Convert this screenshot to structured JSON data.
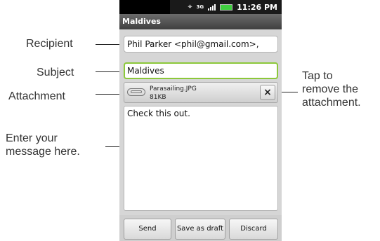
{
  "status_bar": {
    "time": "11:26 PM",
    "network": "3G"
  },
  "title_bar": {
    "title": "Maldives"
  },
  "compose": {
    "recipient_value": "Phil Parker <phil@gmail.com>,",
    "subject_value": "Maldives",
    "attachment": {
      "filename": "Parasailing.JPG",
      "size": "81KB",
      "remove_label": "×"
    },
    "body_text": "Check this out."
  },
  "buttons": {
    "send": "Send",
    "save_draft": "Save as draft",
    "discard": "Discard"
  },
  "callouts": {
    "recipient": "Recipient",
    "subject": "Subject",
    "attachment": "Attachment",
    "message_line1": "Enter your",
    "message_line2": "message here.",
    "remove_line1": "Tap to",
    "remove_line2": "remove the",
    "remove_line3": "attachment."
  },
  "colors": {
    "focus_border": "#8cc83a",
    "battery": "#3fcf3f"
  }
}
